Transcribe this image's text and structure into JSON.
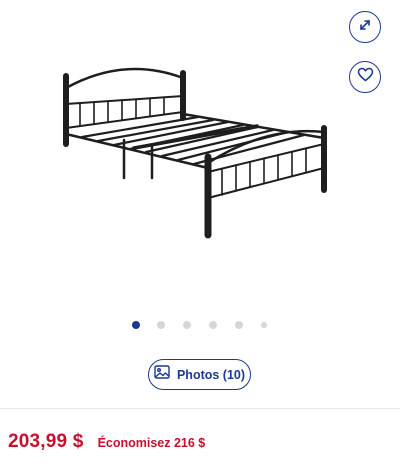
{
  "gallery": {
    "image_alt": "Black metal bed frame with headboard and footboard",
    "expand_icon": "expand-icon",
    "favorite_icon": "heart-icon",
    "slide_count": 6,
    "active_slide": 1
  },
  "photos_button": {
    "icon": "image-icon",
    "label": "Photos (10)"
  },
  "pricing": {
    "price": "203,99 $",
    "savings": "Économisez 216 $"
  },
  "colors": {
    "accent": "#1a3a8f",
    "price_red": "#c8102e"
  }
}
